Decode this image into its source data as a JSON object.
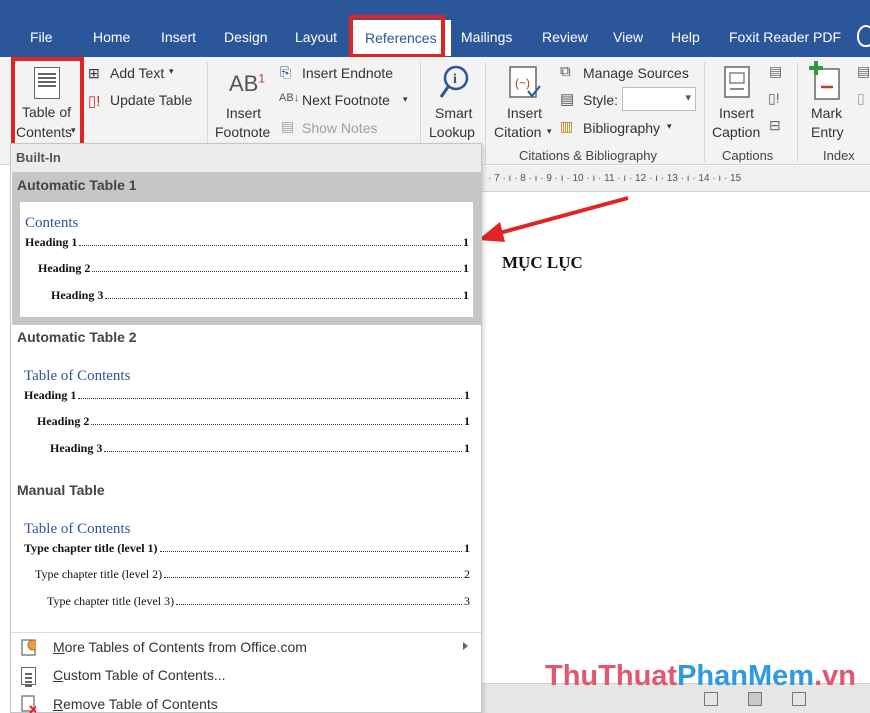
{
  "ribbon_tabs": {
    "file": "File",
    "home": "Home",
    "insert": "Insert",
    "design": "Design",
    "layout": "Layout",
    "references": "References",
    "mailings": "Mailings",
    "review": "Review",
    "view": "View",
    "help": "Help",
    "foxit": "Foxit Reader PDF"
  },
  "ribbon": {
    "toc_line1": "Table of",
    "toc_line2": "Contents",
    "add_text": "Add Text",
    "update_table": "Update Table",
    "insert_footnote_line1": "Insert",
    "insert_footnote_line2": "Footnote",
    "footnote_icon_text": "AB",
    "footnote_icon_sup": "1",
    "insert_endnote": "Insert Endnote",
    "next_footnote": "Next Footnote",
    "show_notes": "Show Notes",
    "smart_lookup_line1": "Smart",
    "smart_lookup_line2": "Lookup",
    "insert_citation_line1": "Insert",
    "insert_citation_line2": "Citation",
    "manage_sources": "Manage Sources",
    "style_label": "Style:",
    "style_value": "",
    "bibliography": "Bibliography",
    "group_citations": "Citations & Bibliography",
    "insert_caption_line1": "Insert",
    "insert_caption_line2": "Caption",
    "group_captions": "Captions",
    "mark_entry_line1": "Mark",
    "mark_entry_line2": "Entry",
    "group_index": "Index"
  },
  "ruler": {
    "text": "· 7 · ı · 8 · ı · 9 · ı · 10 · ı · 11 · ı · 12 · ı · 13 · ı · 14 · ı · 15"
  },
  "document": {
    "heading": "MỤC LỤC"
  },
  "watermark": {
    "part1": "ThuThuat",
    "part2": "PhanMem",
    "part3": ".vn"
  },
  "dropdown": {
    "builtin_label": "Built-In",
    "auto1": {
      "title": "Automatic Table 1",
      "toc_title": "Contents",
      "lines": [
        {
          "text": "Heading 1",
          "page": "1"
        },
        {
          "text": "Heading 2",
          "page": "1"
        },
        {
          "text": "Heading 3",
          "page": "1"
        }
      ]
    },
    "auto2": {
      "title": "Automatic Table 2",
      "toc_title": "Table of Contents",
      "lines": [
        {
          "text": "Heading 1",
          "page": "1"
        },
        {
          "text": "Heading 2",
          "page": "1"
        },
        {
          "text": "Heading 3",
          "page": "1"
        }
      ]
    },
    "manual": {
      "title": "Manual Table",
      "toc_title": "Table of Contents",
      "lines": [
        {
          "text": "Type chapter title (level 1)",
          "page": "1"
        },
        {
          "text": "Type chapter title (level 2)",
          "page": "2"
        },
        {
          "text": "Type chapter title (level 3)",
          "page": "3"
        }
      ]
    },
    "more_tables": {
      "underlined": "M",
      "rest": "ore Tables of Contents from Office.com"
    },
    "custom_table": {
      "underlined": "C",
      "rest": "ustom Table of Contents..."
    },
    "remove_table": {
      "underlined": "R",
      "rest": "emove Table of Contents"
    }
  },
  "colors": {
    "ribbon_blue": "#2b579a",
    "highlight_red": "#e02424",
    "toc_title_blue": "#2f5597"
  }
}
